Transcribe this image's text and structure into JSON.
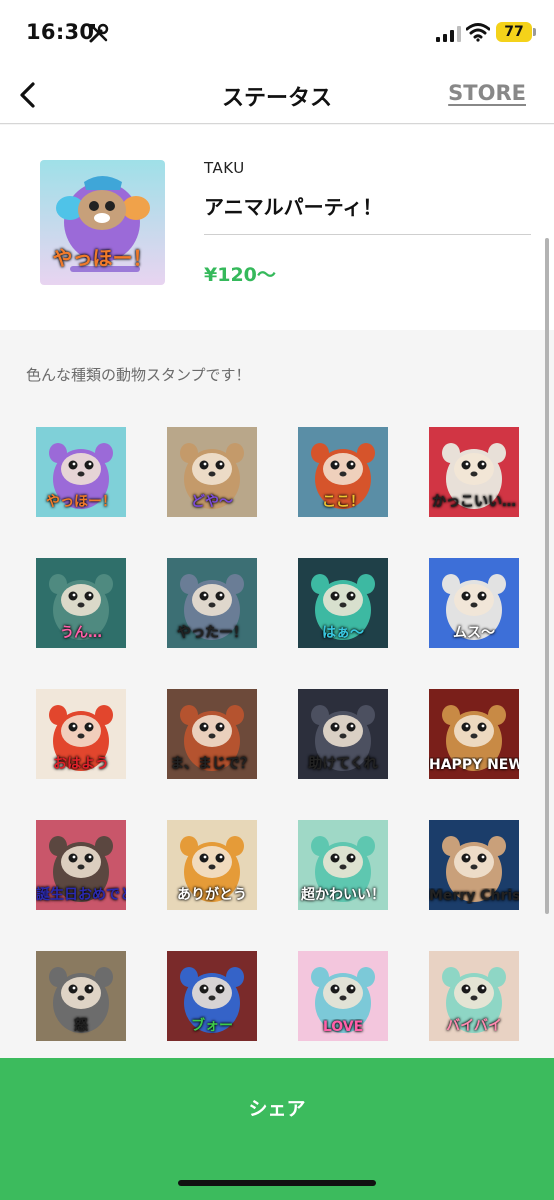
{
  "status_bar": {
    "time": "16:30",
    "battery": "77"
  },
  "nav": {
    "title": "ステータス",
    "store_label": "STORE"
  },
  "product": {
    "creator": "TAKU",
    "title": "アニマルパーティ！",
    "price": "¥120～",
    "thumb_caption": "やっほー！"
  },
  "description": "色んな種類の動物スタンプです！",
  "stickers": [
    {
      "caption": "やっほー！",
      "bg": "#7fd0d8",
      "body": "#9b6ad8",
      "caption_color": "#f07a2a"
    },
    {
      "caption": "どや～",
      "bg": "#b9a78a",
      "body": "#c49a6a",
      "caption_color": "#7b4bd6"
    },
    {
      "caption": "ここ！",
      "bg": "#5a8ea6",
      "body": "#d6542b",
      "caption_color": "#f0c330"
    },
    {
      "caption": "かっこいい…",
      "bg": "#d13544",
      "body": "#e8e0d8",
      "caption_color": "#222"
    },
    {
      "caption": "うん…",
      "bg": "#2f6f6a",
      "body": "#4f8a80",
      "caption_color": "#ff5fa8"
    },
    {
      "caption": "やったー！",
      "bg": "#3c6f74",
      "body": "#6a7d96",
      "caption_color": "#222"
    },
    {
      "caption": "はぁ～",
      "bg": "#1f4048",
      "body": "#3db9a2",
      "caption_color": "#39c8e0"
    },
    {
      "caption": "ムス～",
      "bg": "#3d6fd8",
      "body": "#e2e2e2",
      "caption_color": "#fff"
    },
    {
      "caption": "おはよう",
      "bg": "#f1e7da",
      "body": "#e2462d",
      "caption_color": "#e0202a"
    },
    {
      "caption": "ま、まじで？",
      "bg": "#6d4a3a",
      "body": "#b5532f",
      "caption_color": "#222"
    },
    {
      "caption": "助けてくれ",
      "bg": "#2c2f3c",
      "body": "#4c5060",
      "caption_color": "#222"
    },
    {
      "caption": "HAPPY NEW YEAR",
      "bg": "#7a1f1a",
      "body": "#c88a45",
      "caption_color": "#fff"
    },
    {
      "caption": "誕生日おめでとう！",
      "bg": "#c9566a",
      "body": "#5b4740",
      "caption_color": "#2a2ab0"
    },
    {
      "caption": "ありがとう",
      "bg": "#e7d7b8",
      "body": "#e59b38",
      "caption_color": "#fff"
    },
    {
      "caption": "超かわいい！",
      "bg": "#9fd8c6",
      "body": "#5ec7b0",
      "caption_color": "#fff"
    },
    {
      "caption": "Merry Christmas!",
      "bg": "#1b3d6a",
      "body": "#c9a07a",
      "caption_color": "#222"
    },
    {
      "caption": "怒",
      "bg": "#8a7a60",
      "body": "#6c6c6c",
      "caption_color": "#222"
    },
    {
      "caption": "ブォー",
      "bg": "#7a2a2a",
      "body": "#3563c8",
      "caption_color": "#3ecb4a"
    },
    {
      "caption": "LOVE",
      "bg": "#f3c6dd",
      "body": "#7cc9d8",
      "caption_color": "#ff5fa8"
    },
    {
      "caption": "バイバイ",
      "bg": "#e8d2c3",
      "body": "#8ed6c5",
      "caption_color": "#ff8ab0"
    }
  ],
  "share_label": "シェア",
  "colors": {
    "accent_green": "#3cbb5d",
    "price_green": "#35b95b",
    "battery_yellow": "#f4d21a"
  },
  "icons": [
    "tools-icon",
    "signal-icon",
    "wifi-icon",
    "back-chevron-icon"
  ]
}
